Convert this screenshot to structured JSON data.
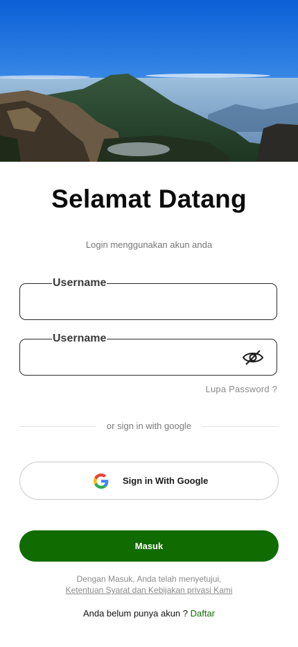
{
  "hero": {
    "image": "mountain-landscape"
  },
  "welcome": {
    "title": "Selamat Datang",
    "subtitle": "Login menggunakan akun anda"
  },
  "form": {
    "username": {
      "label": "Username",
      "value": ""
    },
    "password": {
      "label": "Username",
      "value": "",
      "toggle_icon": "eye-off-icon"
    },
    "forgot_label": "Lupa Password ?"
  },
  "divider": {
    "text": "or sign in with google"
  },
  "google": {
    "label": "Sign in With Google",
    "icon": "google-icon"
  },
  "submit": {
    "label": "Masuk",
    "color": "#106b00"
  },
  "terms": {
    "line1": "Dengan Masuk, Anda telah menyetujui,",
    "link": "Ketentuan Syarat dan Kebijakan privasi Kami"
  },
  "register": {
    "prompt": "Anda belum punya akun ?",
    "link": "Daftar"
  }
}
